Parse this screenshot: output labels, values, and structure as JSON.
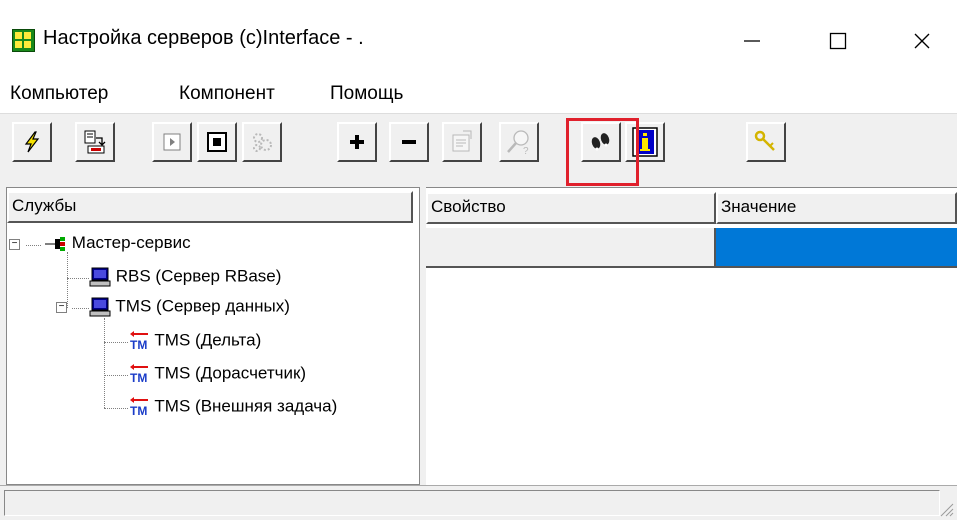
{
  "window": {
    "title": "Настройка серверов (c)Interface - .",
    "controls": {
      "minimize": "—",
      "maximize": "☐",
      "close": "✕"
    }
  },
  "menu": {
    "items": [
      "Компьютер",
      "Компонент",
      "Помощь"
    ]
  },
  "toolbar": {
    "buttons": [
      {
        "icon": "lightning-icon"
      },
      {
        "icon": "import-icon"
      },
      {
        "icon": "play-icon"
      },
      {
        "icon": "stop-icon"
      },
      {
        "icon": "services-icon"
      },
      {
        "icon": "add-icon"
      },
      {
        "icon": "remove-icon"
      },
      {
        "icon": "properties-icon"
      },
      {
        "icon": "find-icon"
      },
      {
        "icon": "footsteps-icon",
        "highlighted": true
      },
      {
        "icon": "info-icon"
      },
      {
        "icon": "key-icon"
      }
    ]
  },
  "left_panel": {
    "header": "Службы",
    "tree": [
      {
        "label": "Мастер-сервис",
        "icon": "network-icon",
        "level": 0
      },
      {
        "label": "RBS (Сервер RBase)",
        "icon": "computer-icon",
        "level": 1
      },
      {
        "label": "TMS (Сервер данных)",
        "icon": "computer-icon",
        "level": 1
      },
      {
        "label": "TMS (Дельта)",
        "icon": "tm-icon",
        "level": 2
      },
      {
        "label": "TMS (Дорасчетчик)",
        "icon": "tm-icon",
        "level": 2
      },
      {
        "label": "TMS (Внешняя задача)",
        "icon": "tm-icon",
        "level": 2
      }
    ]
  },
  "right_panel": {
    "columns": [
      "Свойство",
      "Значение"
    ],
    "row": {
      "property": "",
      "value": ""
    },
    "selected_value_color": "#0078d7"
  },
  "tm_icon_text": "TM"
}
